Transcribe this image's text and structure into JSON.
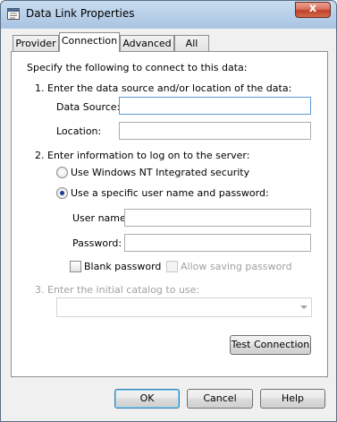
{
  "window": {
    "title": "Data Link Properties",
    "close_symbol": "x"
  },
  "tabs": [
    {
      "label": "Provider",
      "active": false
    },
    {
      "label": "Connection",
      "active": true
    },
    {
      "label": "Advanced",
      "active": false
    },
    {
      "label": "All",
      "active": false
    }
  ],
  "connection": {
    "intro": "Specify the following to connect to this data:",
    "step1": "1. Enter the data source and/or location of the data:",
    "data_source_label": "Data Source:",
    "data_source_value": "",
    "location_label": "Location:",
    "location_value": "",
    "step2": "2. Enter information to log on to the server:",
    "radio_nt": "Use Windows NT Integrated security",
    "radio_specific": "Use a specific user name and password:",
    "username_label": "User name:",
    "username_value": "",
    "password_label": "Password:",
    "password_value": "",
    "blank_password_label": "Blank password",
    "blank_password_checked": false,
    "allow_saving_label": "Allow saving password",
    "allow_saving_checked": false,
    "step3": "3. Enter the initial catalog to use:",
    "catalog_value": "",
    "test_button": "Test Connection"
  },
  "footer": {
    "ok": "OK",
    "cancel": "Cancel",
    "help": "Help"
  }
}
